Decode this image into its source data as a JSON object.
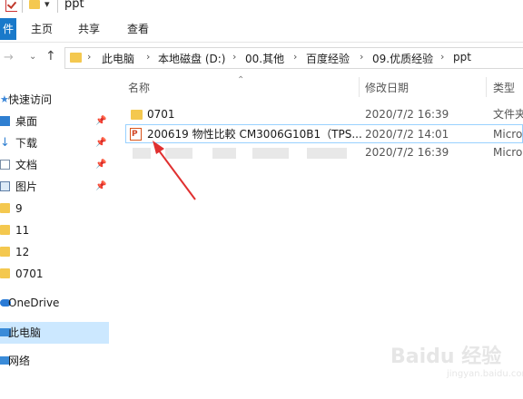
{
  "title": "ppt",
  "ribbon": {
    "file_tab": "件",
    "tabs": [
      "主页",
      "共享",
      "查看"
    ]
  },
  "address": {
    "crumbs": [
      "此电脑",
      "本地磁盘 (D:)",
      "00.其他",
      "百度经验",
      "09.优质经验",
      "ppt"
    ]
  },
  "nav": {
    "quick_access": "快速访问",
    "items": [
      {
        "label": "桌面"
      },
      {
        "label": "下载"
      },
      {
        "label": "文档"
      },
      {
        "label": "图片"
      },
      {
        "label": "9"
      },
      {
        "label": "11"
      },
      {
        "label": "12"
      },
      {
        "label": "0701"
      }
    ],
    "onedrive": "OneDrive",
    "this_pc": "此电脑",
    "network": "网络"
  },
  "columns": {
    "name": "名称",
    "modified": "修改日期",
    "type": "类型"
  },
  "files": [
    {
      "name": "0701",
      "date": "2020/7/2 16:39",
      "type": "文件夹"
    },
    {
      "name": "200619 物性比較 CM3006G10B1（TPS...",
      "date": "2020/7/2 14:01",
      "type": "Micro"
    },
    {
      "name": "",
      "date": "2020/7/2 16:39",
      "type": "Micro"
    }
  ],
  "watermark": {
    "text": "Baidu 经验",
    "sub": "jingyan.baidu.com"
  },
  "colors": {
    "accent": "#1979ca",
    "selection": "#cce8ff",
    "folder": "#f4c84f",
    "annotation_arrow": "#e03030"
  }
}
